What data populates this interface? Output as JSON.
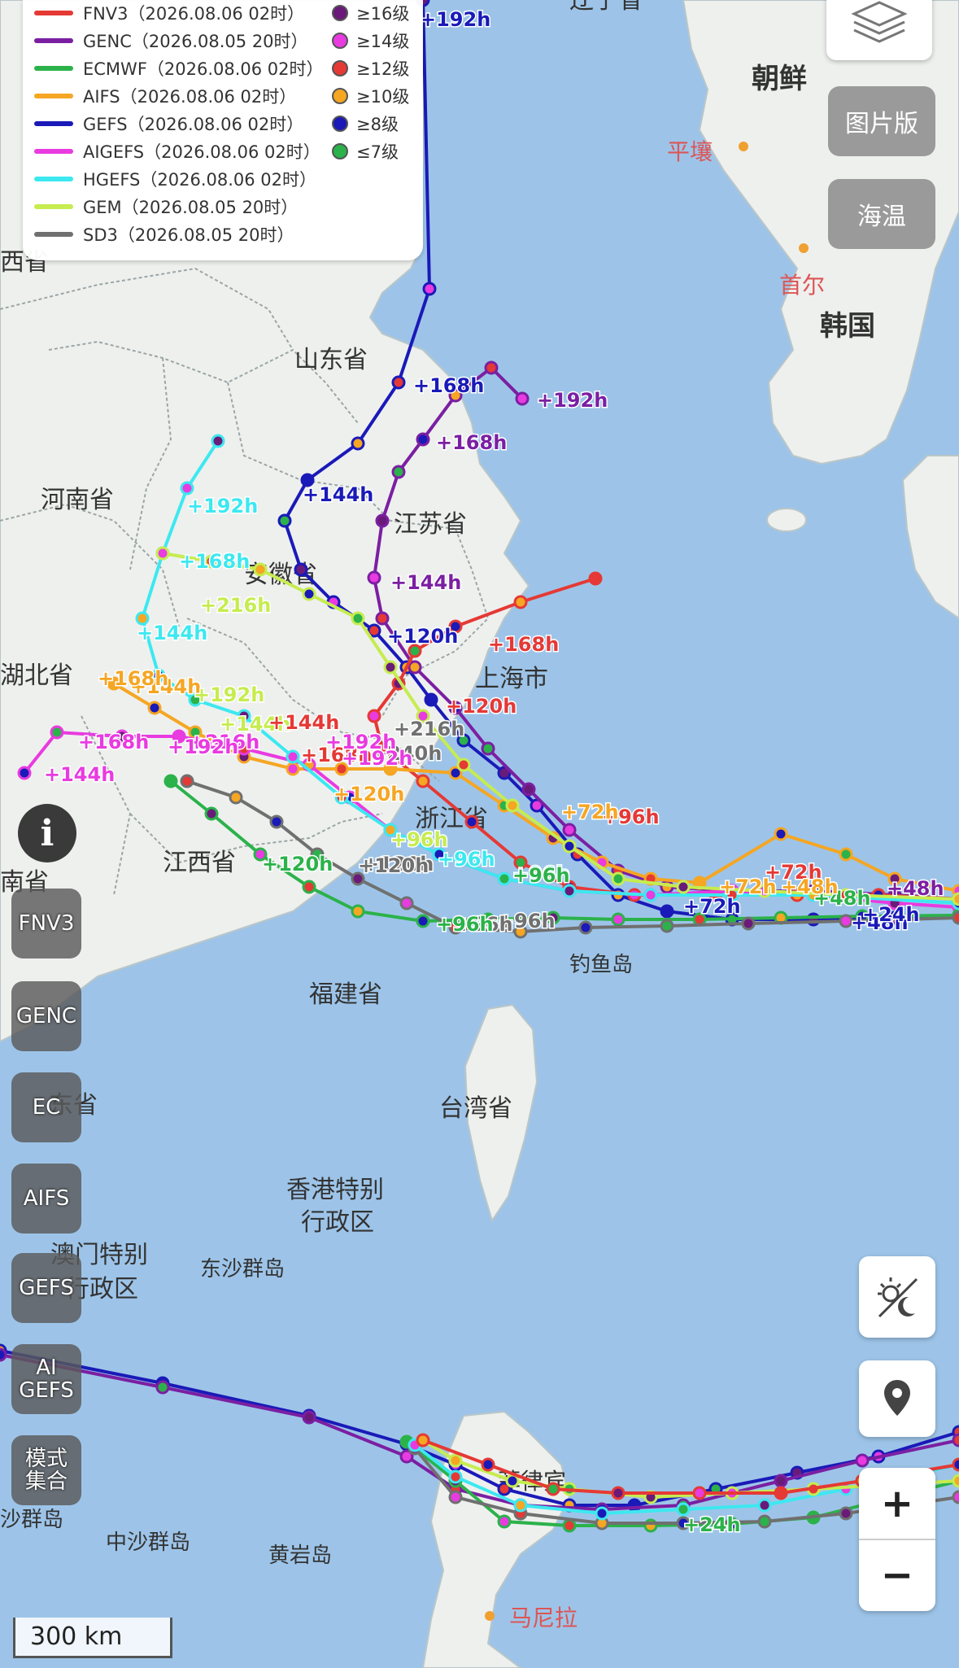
{
  "legend": {
    "models": [
      {
        "label": "FNV3（2026.08.06 02时）",
        "color": "#e53935"
      },
      {
        "label": "GENC（2026.08.05 20时）",
        "color": "#7b1fa2"
      },
      {
        "label": "ECMWF（2026.08.06 02时）",
        "color": "#2bb24a"
      },
      {
        "label": "AIFS（2026.08.06 02时）",
        "color": "#f5a623"
      },
      {
        "label": "GEFS（2026.08.06 02时）",
        "color": "#1a1ab8"
      },
      {
        "label": "AIGEFS（2026.08.06 02时）",
        "color": "#e83be0"
      },
      {
        "label": "HGEFS（2026.08.06 02时）",
        "color": "#3de8f0"
      },
      {
        "label": "GEM（2026.08.05 20时）",
        "color": "#c6ec4f"
      },
      {
        "label": "SD3（2026.08.05 20时）",
        "color": "#707070"
      }
    ],
    "levels": [
      {
        "label": "≥16级",
        "color": "#6a1b7a"
      },
      {
        "label": "≥14级",
        "color": "#e83be0"
      },
      {
        "label": "≥12级",
        "color": "#e53935"
      },
      {
        "label": "≥10级",
        "color": "#f5a623"
      },
      {
        "label": "≥8级",
        "color": "#1a1ab8"
      },
      {
        "label": "≤7级",
        "color": "#2bb24a"
      }
    ]
  },
  "right_buttons": {
    "picture_version": "图片版",
    "sst": "海温"
  },
  "left_buttons": [
    "FNV3",
    "GENC",
    "EC",
    "AIFS",
    "GEFS",
    "AI\nGEFS",
    "模式\n集合"
  ],
  "info_glyph": "i",
  "scale_label": "300 km",
  "zoom": {
    "in": "+",
    "out": "−"
  },
  "places": {
    "liaoning": "辽宁省",
    "korea_n": "朝鲜",
    "pyongyang": "平壤",
    "seoul": "首尔",
    "korea_s": "韩国",
    "shandong": "山东省",
    "henan": "河南省",
    "jiangsu": "江苏省",
    "anhui": "安徽省",
    "hubei": "湖北省",
    "shanghai": "上海市",
    "zhejiang": "浙江省",
    "jiangxi": "江西省",
    "fujian": "福建省",
    "diaoyu": "钓鱼岛",
    "taiwan": "台湾省",
    "guangdong": "东省",
    "hk1": "香港特别",
    "hk2": "行政区",
    "macau1": "澳门特别",
    "macau2": "行政区",
    "dongsha": "东沙群岛",
    "zhongsha": "中沙群岛",
    "huangyan": "黄岩岛",
    "manila": "马尼拉",
    "luzon": "菲律宾",
    "shaanxi": "西省",
    "hunan": "南省",
    "xisha": "沙群岛"
  },
  "track_labels": [
    "+192h",
    "+168h",
    "+192h",
    "+168h",
    "+144h",
    "+144h",
    "+120h",
    "+168h",
    "+192h",
    "+216h",
    "+144h",
    "+168h",
    "+216h",
    "+144h",
    "+168h",
    "+192h",
    "+144h",
    "+192h",
    "+168h",
    "+144h",
    "+120h",
    "+144h",
    "+168h",
    "+120h",
    "+120h",
    "+216h",
    "+240h",
    "+192h",
    "+96h",
    "+96h",
    "+96h",
    "+96h",
    "+96h",
    "+72h",
    "+72h",
    "+72h",
    "+48h",
    "+48h",
    "+48h",
    "+24h",
    "+120h",
    "+96h",
    "+120h",
    "+72h",
    "+48h",
    "+24h",
    "+192h",
    "+96h",
    "+96h"
  ]
}
